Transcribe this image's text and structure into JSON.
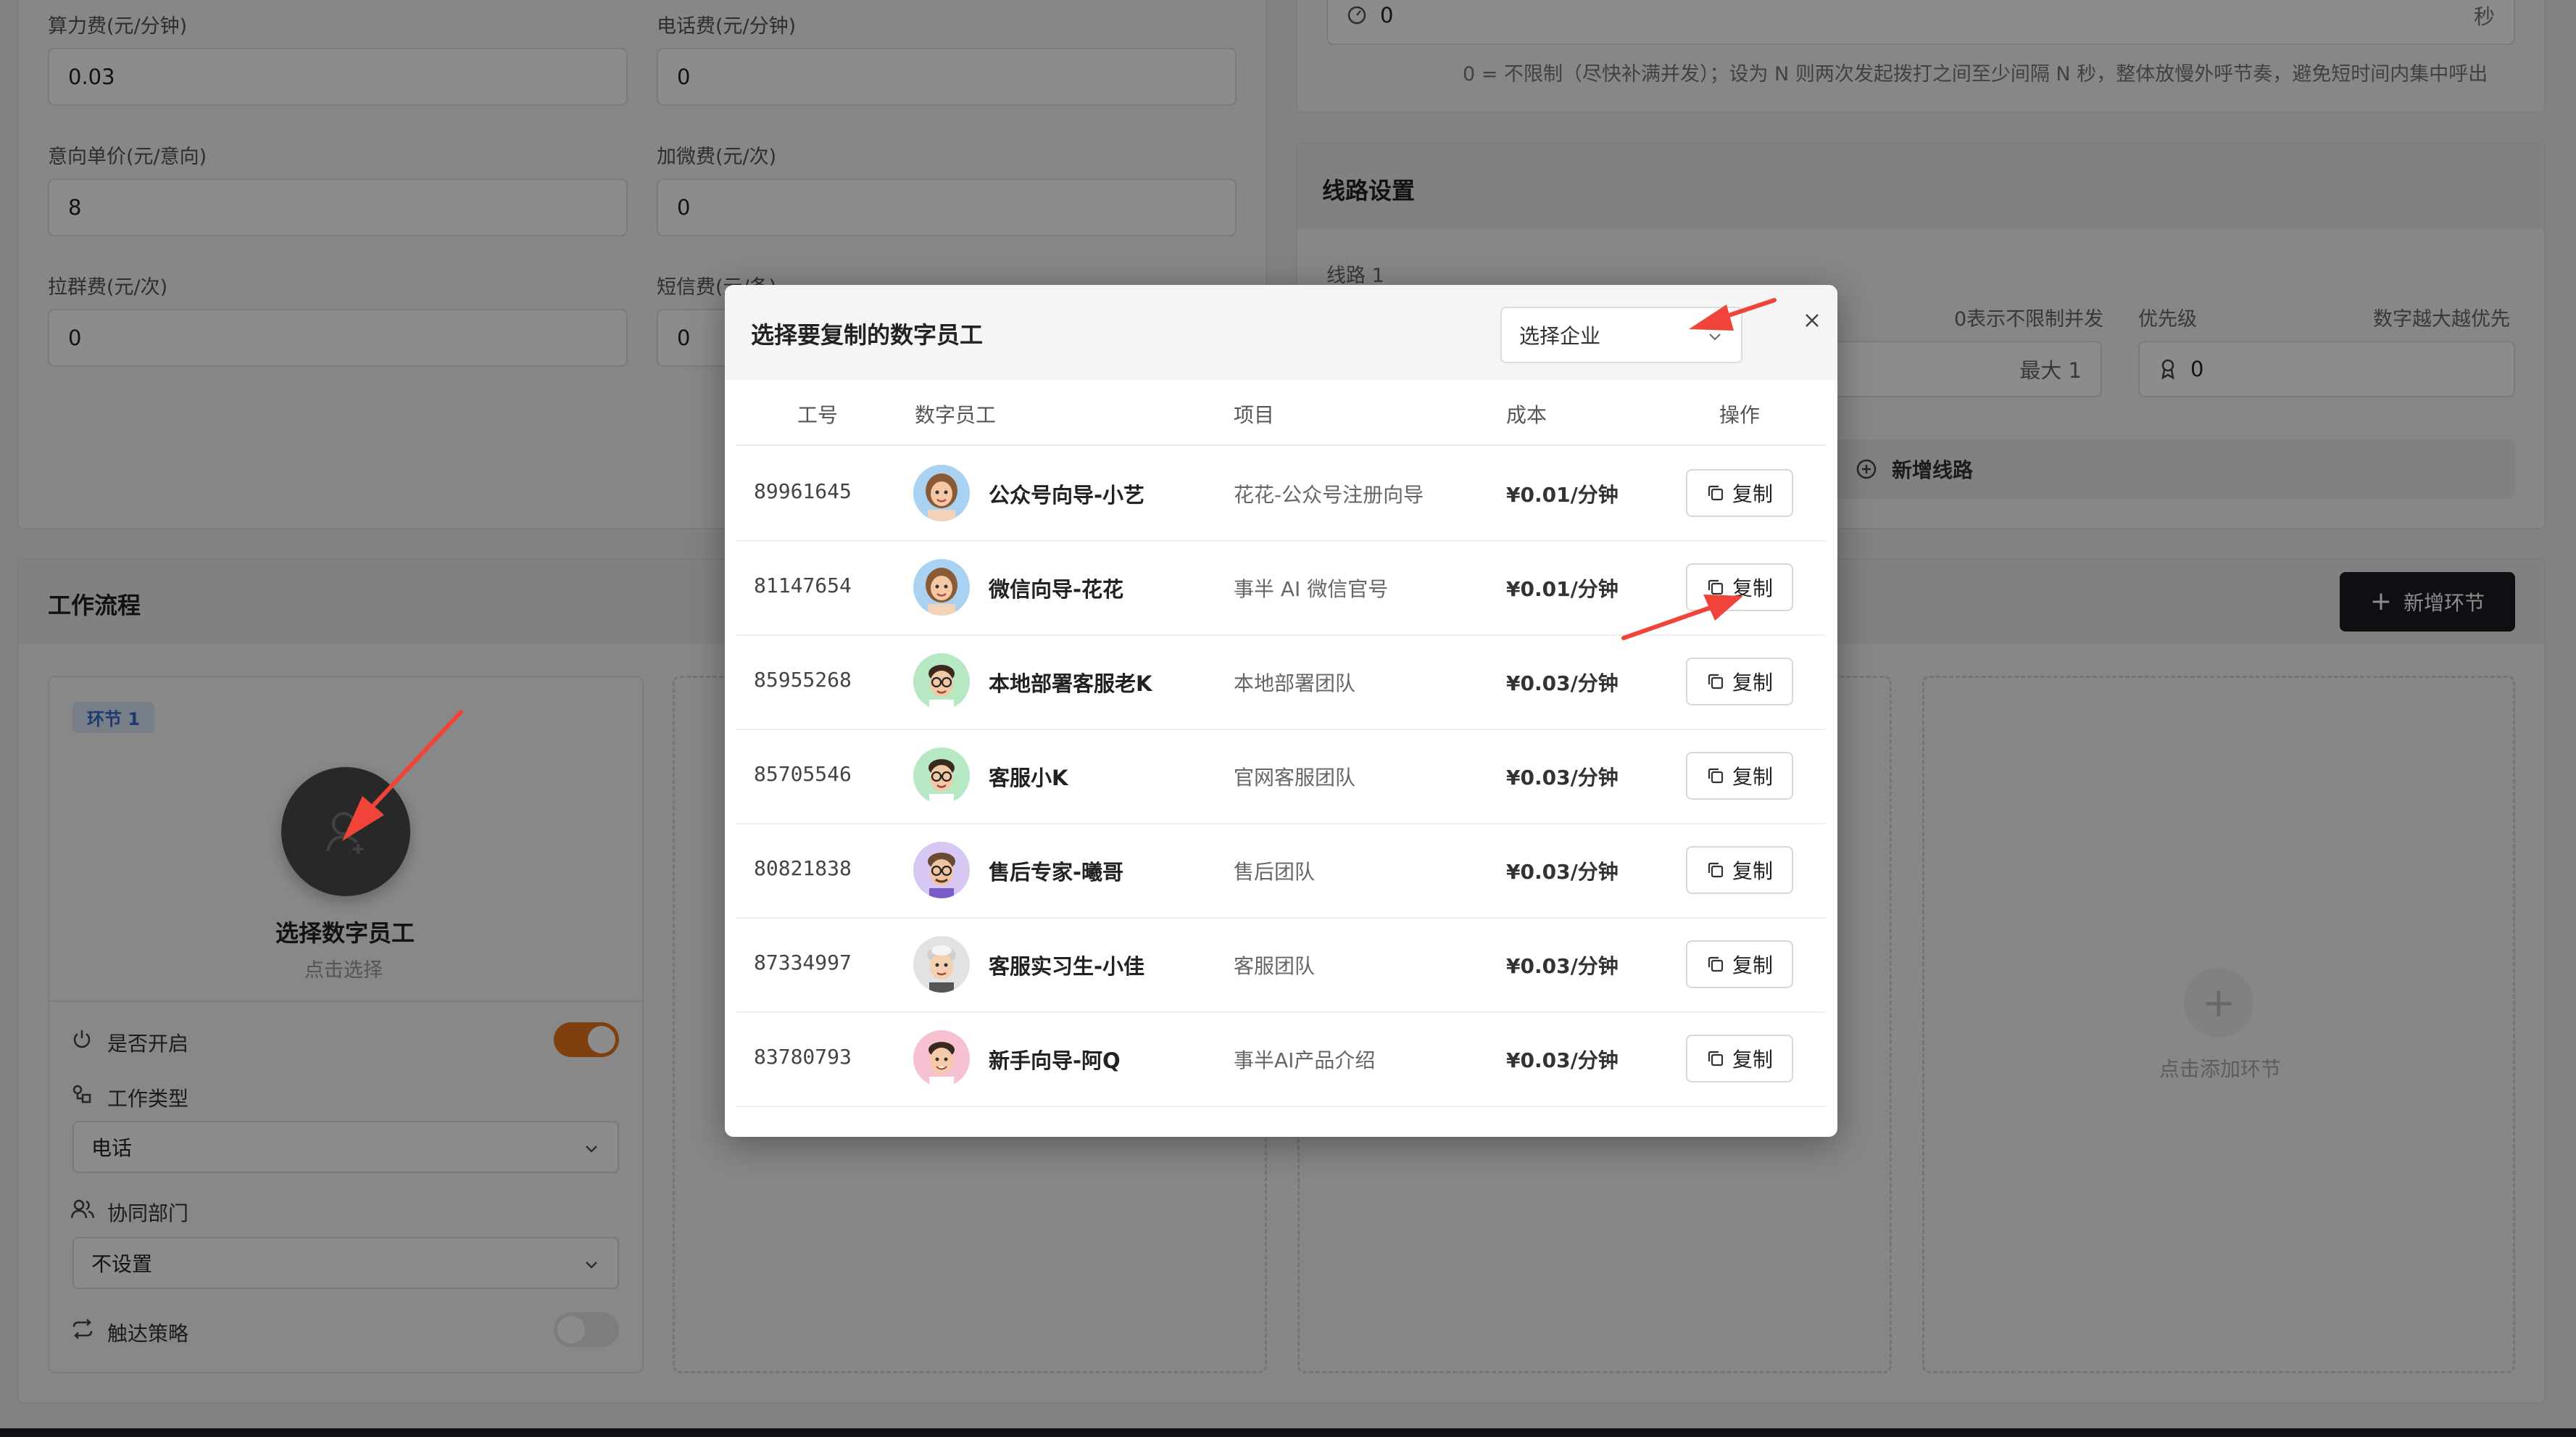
{
  "fees": {
    "compute_label": "算力费(元/分钟)",
    "compute_value": "0.03",
    "phone_label": "电话费(元/分钟)",
    "phone_value": "0",
    "intent_label": "意向单价(元/意向)",
    "intent_value": "8",
    "wechat_label": "加微费(元/次)",
    "wechat_value": "0",
    "group_label": "拉群费(元/次)",
    "group_value": "0",
    "sms_label": "短信费(元/条)",
    "sms_value": "0"
  },
  "interval": {
    "value": "0",
    "unit": "秒",
    "hint": "0 = 不限制（尽快补满并发）；设为 N 则两次发起拨打之间至少间隔 N 秒，整体放慢外呼节奏，避免短时间内集中呼出"
  },
  "lines": {
    "section_title": "线路设置",
    "line_label": "线路 1",
    "concurrency_hint": "0表示不限制并发",
    "max_value": "最大 1",
    "priority_label": "优先级",
    "priority_hint": "数字越大越优先",
    "priority_value": "0",
    "add_line": "新增线路"
  },
  "workflow": {
    "title": "工作流程",
    "add_step": "新增环节",
    "step_badge": "环节 1",
    "select_employee": "选择数字员工",
    "click_to_select": "点击选择",
    "enabled_label": "是否开启",
    "work_type_label": "工作类型",
    "work_type_value": "电话",
    "dept_label": "协同部门",
    "dept_value": "不设置",
    "reach_label": "触达策略",
    "add_step_hint": "点击添加环节"
  },
  "modal": {
    "title": "选择要复制的数字员工",
    "company_placeholder": "选择企业",
    "columns": [
      "工号",
      "数字员工",
      "项目",
      "成本",
      "操作"
    ],
    "copy_label": "复制",
    "rows": [
      {
        "id": "89961645",
        "name": "公众号向导-小艺",
        "project": "花花-公众号注册向导",
        "cost": "¥0.01/分钟"
      },
      {
        "id": "81147654",
        "name": "微信向导-花花",
        "project": "事半 AI 微信官号",
        "cost": "¥0.01/分钟"
      },
      {
        "id": "85955268",
        "name": "本地部署客服老K",
        "project": "本地部署团队",
        "cost": "¥0.03/分钟"
      },
      {
        "id": "85705546",
        "name": "客服小K",
        "project": "官网客服团队",
        "cost": "¥0.03/分钟"
      },
      {
        "id": "80821838",
        "name": "售后专家-曦哥",
        "project": "售后团队",
        "cost": "¥0.03/分钟"
      },
      {
        "id": "87334997",
        "name": "客服实习生-小佳",
        "project": "客服团队",
        "cost": "¥0.03/分钟"
      },
      {
        "id": "83780793",
        "name": "新手向导-阿Q",
        "project": "事半AI产品介绍",
        "cost": "¥0.03/分钟"
      }
    ]
  },
  "colors": {
    "accent_orange": "#e8731a",
    "annotation_red": "#f0443b",
    "dark_button": "#1a1d24"
  }
}
